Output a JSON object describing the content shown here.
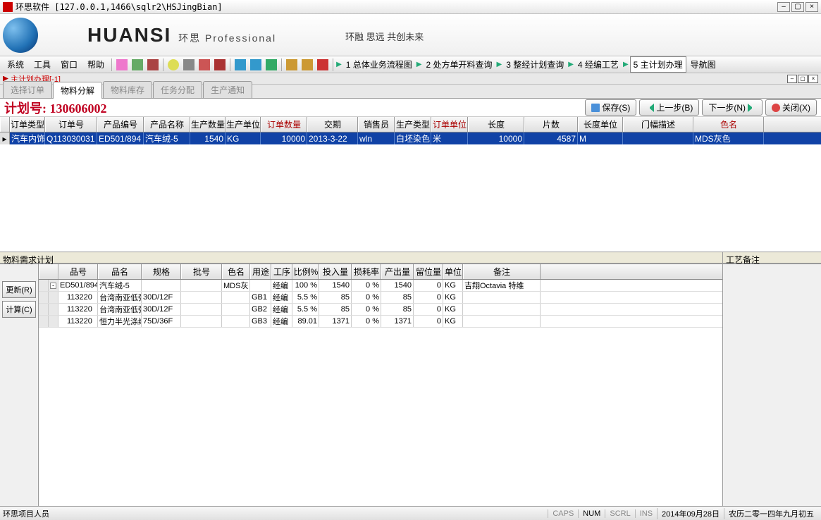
{
  "window": {
    "title": "环思软件 [127.0.0.1,1466\\sqlr2\\HSJingBian]"
  },
  "banner": {
    "logo_en": "HUANSI",
    "logo_cn": "环思 Professional",
    "slogan": "环融 思远 共创未来"
  },
  "menubar": {
    "items": [
      "系统",
      "工具",
      "窗口",
      "帮助"
    ],
    "steps": [
      "1 总体业务流程图",
      "2 处方单开料查询",
      "3 整经计划查询",
      "4 经编工艺",
      "5 主计划办理",
      "导航图"
    ],
    "active_step": 4
  },
  "subtitle": "主计划办理[-1]",
  "tabs": {
    "items": [
      "选择订单",
      "物料分解",
      "物料库存",
      "任务分配",
      "生产通知"
    ],
    "active": 1
  },
  "plan": {
    "label": "计划号:",
    "number": "130606002"
  },
  "actions": {
    "save": "保存(S)",
    "prev": "上一步(B)",
    "next": "下一步(N)",
    "close": "关闭(X)"
  },
  "order_table": {
    "columns": [
      "订单类型",
      "订单号",
      "产品编号",
      "产品名称",
      "生产数量",
      "生产单位",
      "订单数量",
      "交期",
      "销售员",
      "生产类型",
      "订单单位",
      "长度",
      "片数",
      "长度单位",
      "门幅描述",
      "色名"
    ],
    "widths": [
      50,
      74,
      66,
      66,
      50,
      50,
      66,
      72,
      52,
      52,
      52,
      80,
      76,
      64,
      100,
      100
    ],
    "red_cols": [
      6,
      10,
      15
    ],
    "rows": [
      {
        "cells": [
          "汽车内饰",
          "Q113030031",
          "ED501/894",
          "汽车绒-5",
          "1540",
          "KG",
          "10000",
          "2013-3-22",
          "wln",
          "白坯染色",
          "米",
          "10000",
          "4587",
          "M",
          "",
          "MDS灰色"
        ]
      }
    ]
  },
  "material": {
    "title": "物料需求计划",
    "btns": {
      "refresh": "更新(R)",
      "calc": "计算(C)"
    },
    "columns": [
      "品号",
      "品名",
      "规格",
      "批号",
      "色名",
      "用途",
      "工序",
      "比例%",
      "投入量",
      "损耗率",
      "产出量",
      "留位量",
      "单位",
      "备注"
    ],
    "widths": [
      56,
      62,
      56,
      58,
      40,
      30,
      30,
      38,
      46,
      42,
      46,
      42,
      28,
      110
    ],
    "rows": [
      {
        "level": 0,
        "exp": "-",
        "cells": [
          "ED501/894",
          "汽车绒-5",
          "",
          "",
          "MDS灰",
          "",
          "经编",
          "100 %",
          "1540",
          "0 %",
          "1540",
          "0",
          "KG",
          "吉翔Octavia 特维"
        ]
      },
      {
        "level": 1,
        "exp": "",
        "cells": [
          "113220",
          "台湾南亚低弹丝",
          "30D/12F",
          "",
          "",
          "GB1",
          "经编",
          "5.5 %",
          "85",
          "0 %",
          "85",
          "0",
          "KG",
          ""
        ]
      },
      {
        "level": 1,
        "exp": "",
        "cells": [
          "113220",
          "台湾南亚低弹丝",
          "30D/12F",
          "",
          "",
          "GB2",
          "经编",
          "5.5 %",
          "85",
          "0 %",
          "85",
          "0",
          "KG",
          ""
        ]
      },
      {
        "level": 1,
        "exp": "",
        "cells": [
          "113220",
          "恒力半光涤纶丝",
          "75D/36F",
          "",
          "",
          "GB3",
          "经编",
          "89.01",
          "1371",
          "0 %",
          "1371",
          "0",
          "KG",
          ""
        ]
      }
    ]
  },
  "craft_note": "工艺备注",
  "statusbar": {
    "user": "环思项目人员",
    "caps": "CAPS",
    "num": "NUM",
    "scrl": "SCRL",
    "ins": "INS",
    "date": "2014年09月28日",
    "lunar": "农历二零一四年九月初五"
  }
}
